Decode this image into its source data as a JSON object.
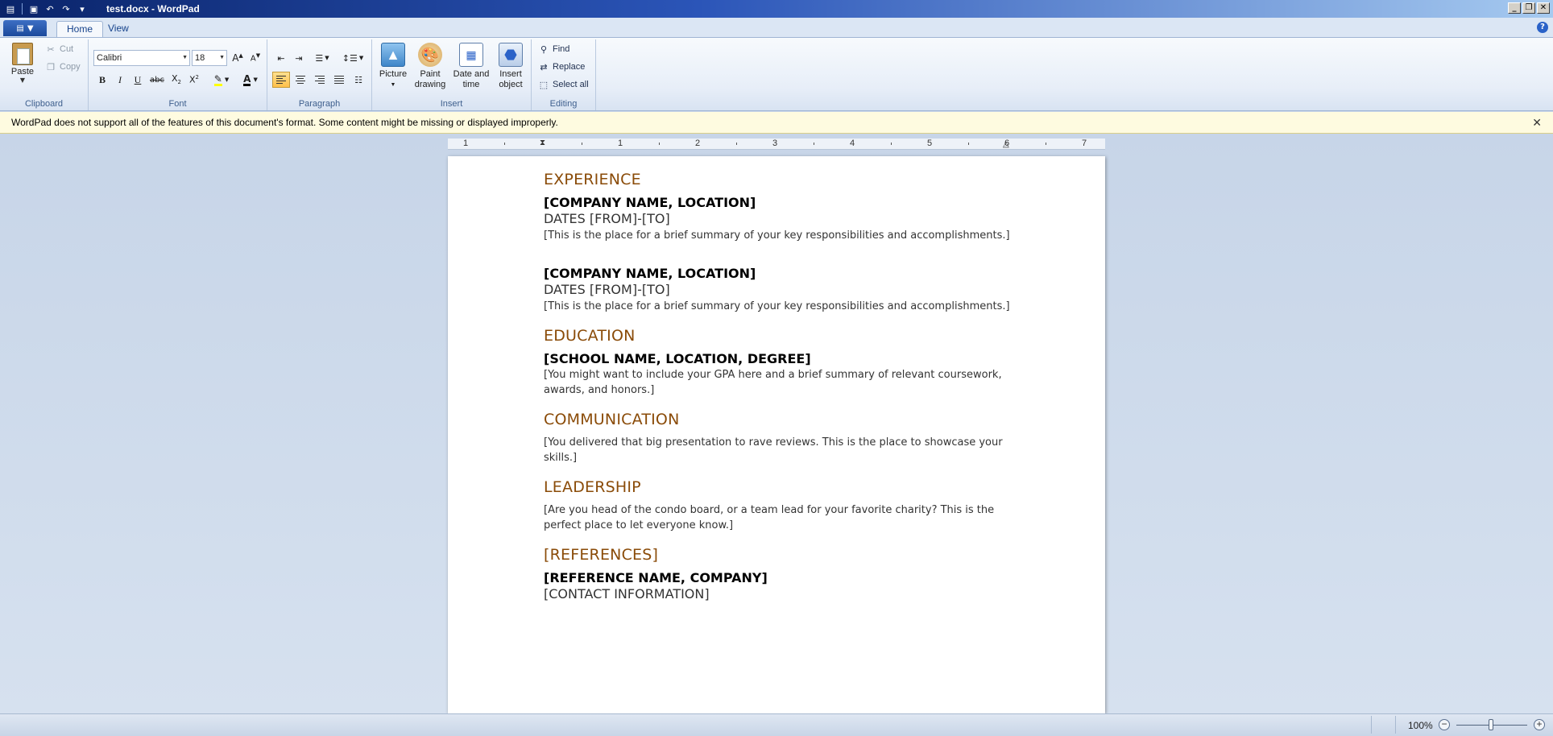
{
  "window": {
    "title": "test.docx - WordPad"
  },
  "tabs": [
    {
      "label": "Home",
      "active": true
    },
    {
      "label": "View",
      "active": false
    }
  ],
  "ribbon": {
    "clipboard": {
      "group_label": "Clipboard",
      "paste": "Paste",
      "cut": "Cut",
      "copy": "Copy"
    },
    "font": {
      "group_label": "Font",
      "family": "Calibri",
      "size": "18"
    },
    "paragraph": {
      "group_label": "Paragraph"
    },
    "insert": {
      "group_label": "Insert",
      "picture": "Picture",
      "paint_line1": "Paint",
      "paint_line2": "drawing",
      "date_line1": "Date and",
      "date_line2": "time",
      "object_line1": "Insert",
      "object_line2": "object"
    },
    "editing": {
      "group_label": "Editing",
      "find": "Find",
      "replace": "Replace",
      "select_all": "Select all"
    }
  },
  "message_bar": {
    "text": "WordPad does not support all of the features of this document's format. Some content might be missing or displayed improperly."
  },
  "ruler": {
    "numbers": [
      "1",
      "1",
      "2",
      "3",
      "4",
      "5",
      "6",
      "7"
    ]
  },
  "document": {
    "experience_heading": "EXPERIENCE",
    "job1_title": "[COMPANY NAME, LOCATION]",
    "job1_dates": "DATES [FROM]-[TO]",
    "job1_summary": "[This is the place for a brief summary of your key responsibilities and accomplishments.]",
    "job2_title": "[COMPANY NAME, LOCATION]",
    "job2_dates": "DATES [FROM]-[TO]",
    "job2_summary": "[This is the place for a brief summary of your key responsibilities and accomplishments.]",
    "education_heading": "EDUCATION",
    "school_title": "[SCHOOL NAME, LOCATION, DEGREE]",
    "school_line1": "[You might want to include your GPA here and a brief summary of relevant coursework,",
    "school_line2": "awards, and honors.]",
    "communication_heading": "COMMUNICATION",
    "comm_line1": "[You delivered that big presentation to rave reviews. This is the place to showcase your",
    "comm_line2": "skills.]",
    "leadership_heading": "LEADERSHIP",
    "lead_line1": "[Are you head of the condo board, or a team lead for your favorite charity? This is the",
    "lead_line2": "perfect place to let everyone know.]",
    "references_heading": "[REFERENCES]",
    "ref_title": "[REFERENCE NAME, COMPANY]",
    "ref_contact": "[CONTACT INFORMATION]"
  },
  "status": {
    "zoom": "100%"
  },
  "colors": {
    "heading": "#8a4b08",
    "titlebar": "#0a246a",
    "message_bar": "#fefbe0"
  }
}
